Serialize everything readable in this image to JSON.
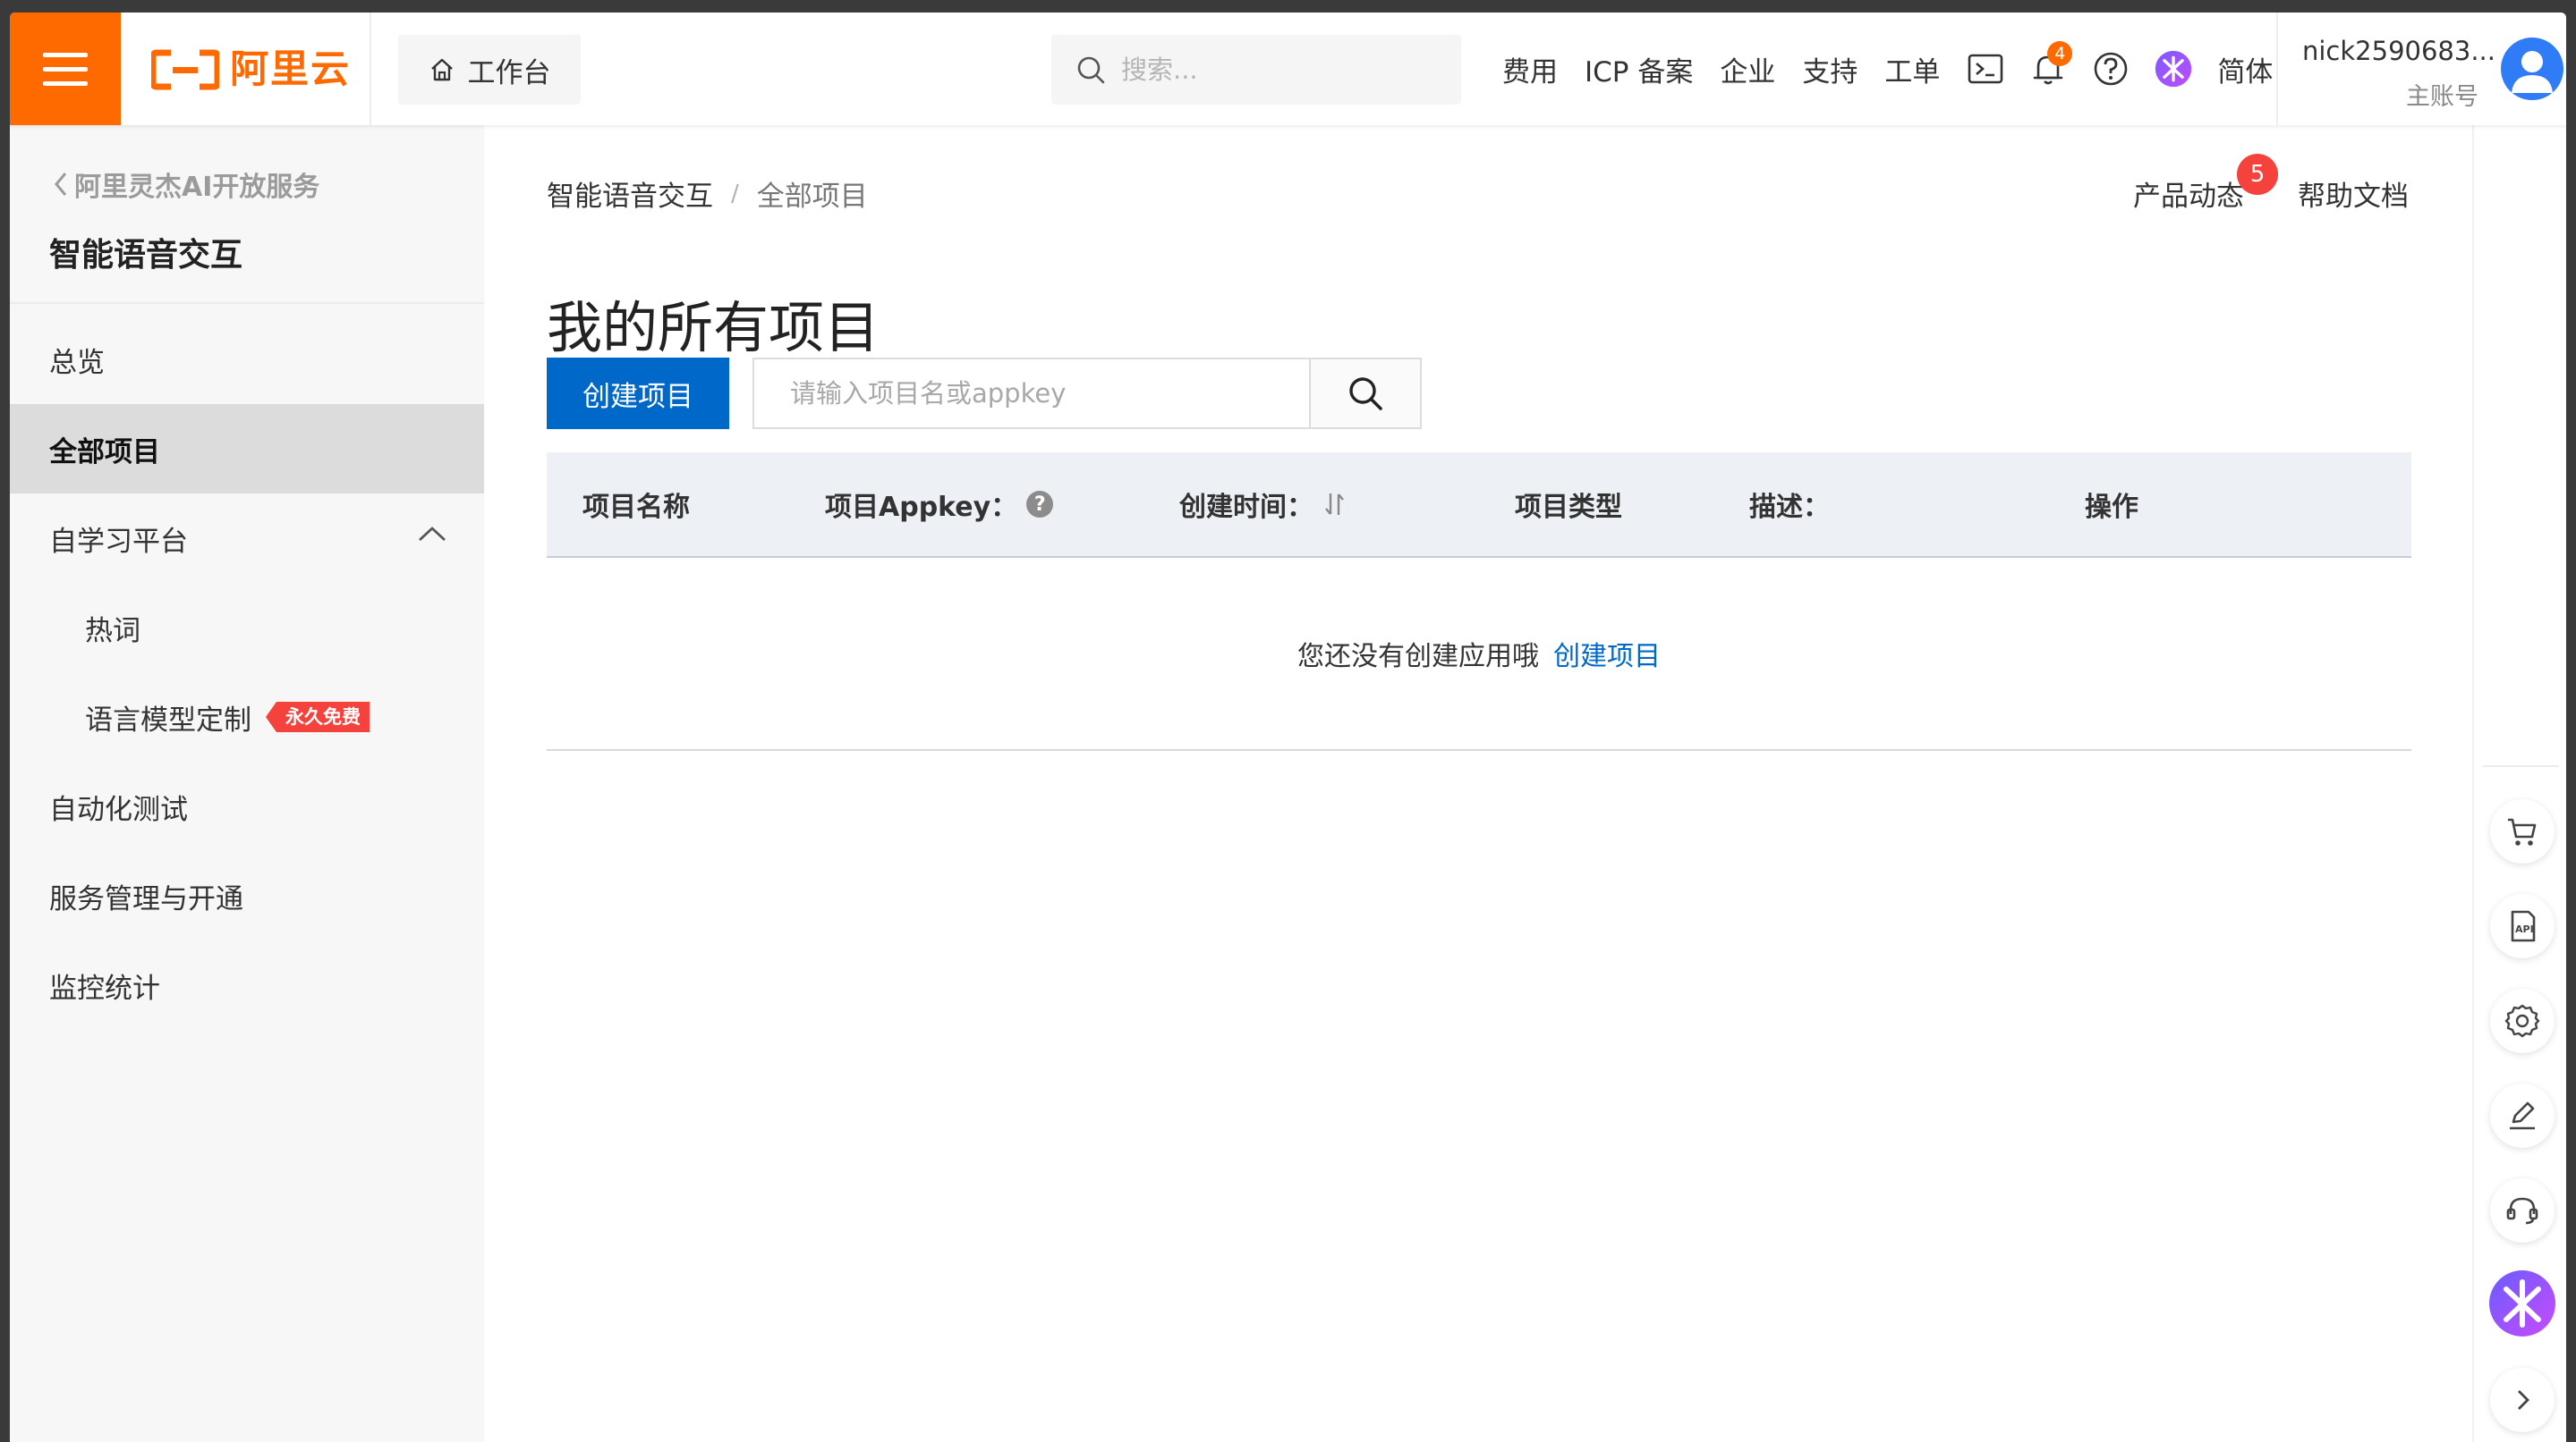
{
  "header": {
    "logo_text": "阿里云",
    "workbench_label": "工作台",
    "search_placeholder": "搜索...",
    "nav": {
      "fees": "费用",
      "icp": "ICP 备案",
      "enterprise": "企业",
      "support": "支持",
      "ticket": "工单",
      "language": "简体"
    },
    "notification_count": "4",
    "user": {
      "name": "nick2590683...",
      "role": "主账号"
    }
  },
  "sidebar": {
    "back_label": "阿里灵杰AI开放服务",
    "title": "智能语音交互",
    "items": {
      "overview": "总览",
      "all_projects": "全部项目",
      "self_learning": "自学习平台",
      "hot_words": "热词",
      "lm_custom": "语言模型定制",
      "lm_custom_tag": "永久免费",
      "auto_test": "自动化测试",
      "service_mgmt": "服务管理与开通",
      "monitoring": "监控统计"
    }
  },
  "main": {
    "breadcrumb": {
      "home": "智能语音交互",
      "separator": "/",
      "current": "全部项目"
    },
    "product_news": "产品动态",
    "product_news_badge": "5",
    "help_docs": "帮助文档",
    "page_title": "我的所有项目",
    "create_button": "创建项目",
    "search_placeholder": "请输入项目名或appkey",
    "table": {
      "columns": {
        "name": "项目名称",
        "appkey": "项目Appkey：",
        "created": "创建时间：",
        "type": "项目类型",
        "desc": "描述：",
        "actions": "操作"
      },
      "empty_text": "您还没有创建应用哦",
      "empty_link": "创建项目"
    }
  },
  "colors": {
    "brand_orange": "#ff6a00",
    "primary_blue": "#0068c8",
    "badge_red": "#f5423d"
  }
}
